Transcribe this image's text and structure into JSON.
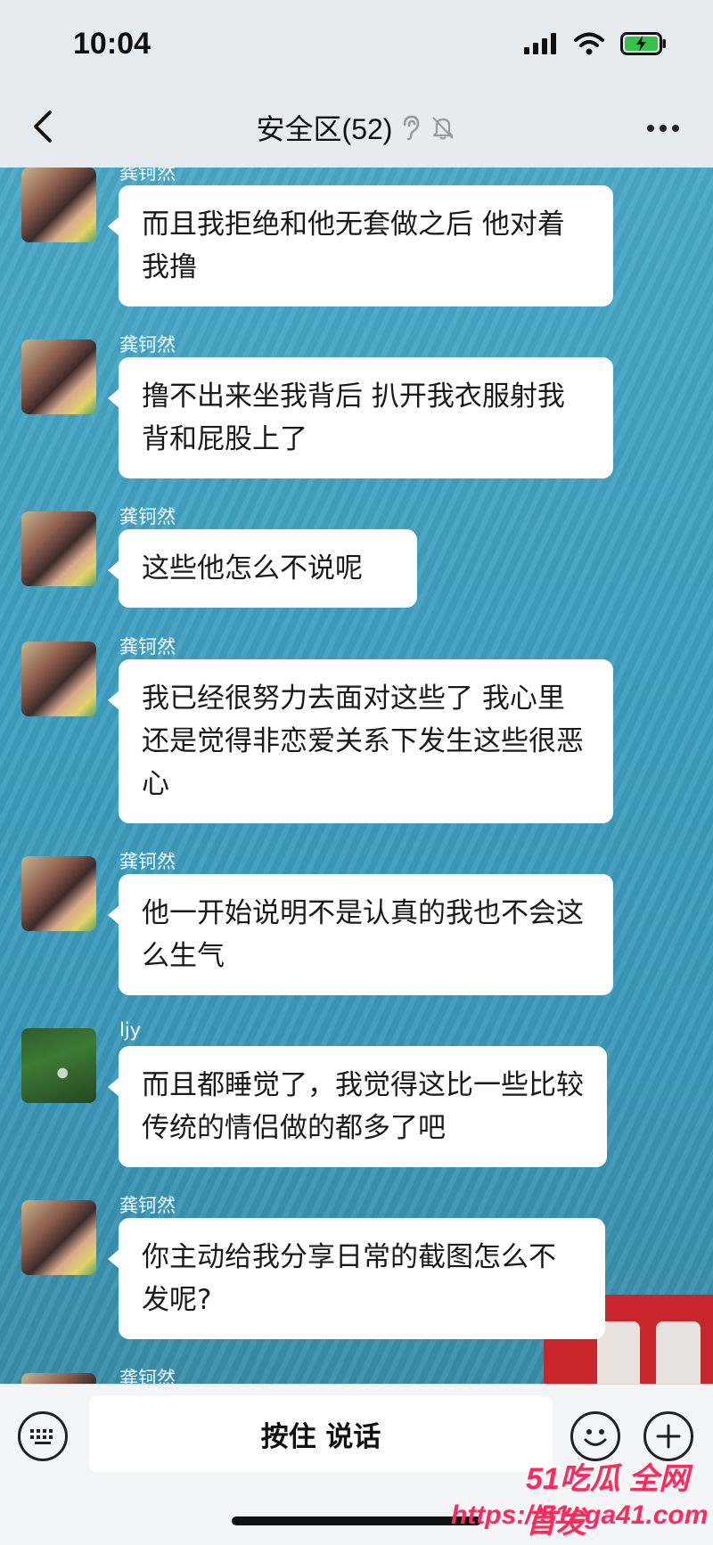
{
  "status": {
    "time": "10:04"
  },
  "header": {
    "title": "安全区(52)"
  },
  "messages": [
    {
      "sender": "龚钶然",
      "text": "而且我拒绝和他无套做之后 他对着我撸",
      "avatar": "a1"
    },
    {
      "sender": "龚钶然",
      "text": "撸不出来坐我背后 扒开我衣服射我背和屁股上了",
      "avatar": "a1"
    },
    {
      "sender": "龚钶然",
      "text": "这些他怎么不说呢",
      "avatar": "a1"
    },
    {
      "sender": "龚钶然",
      "text": "我已经很努力去面对这些了 我心里还是觉得非恋爱关系下发生这些很恶心",
      "avatar": "a1"
    },
    {
      "sender": "龚钶然",
      "text": "他一开始说明不是认真的我也不会这么生气",
      "avatar": "a1"
    },
    {
      "sender": "ljy",
      "text": "而且都睡觉了，我觉得这比一些比较传统的情侣做的都多了吧",
      "avatar": "a2"
    },
    {
      "sender": "龚钶然",
      "text": "你主动给我分享日常的截图怎么不发呢?",
      "avatar": "a1"
    },
    {
      "sender": "龚钶然",
      "text": "",
      "avatar": "a1"
    }
  ],
  "input": {
    "talk_label": "按住 说话"
  },
  "watermark": {
    "line1": "51吃瓜 全网首发",
    "line2": "https://51cga41.com"
  },
  "colors": {
    "chat_bg": "#3f9fbe",
    "bubble": "#ffffff",
    "watermark": "#ff2a5a"
  },
  "icons": [
    "back-arrow-icon",
    "ear-icon",
    "mute-bell-icon",
    "more-icon",
    "keyboard-icon",
    "emoji-icon",
    "plus-icon",
    "signal-icon",
    "wifi-icon",
    "battery-icon"
  ]
}
